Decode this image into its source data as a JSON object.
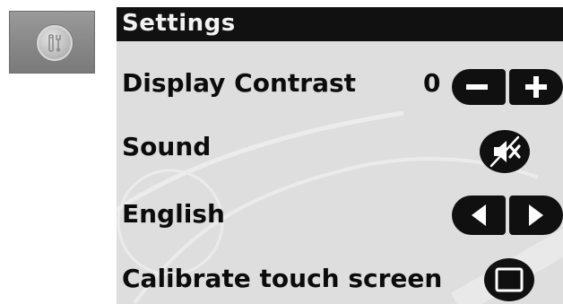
{
  "tool_tile": {
    "icon": "tools-icon"
  },
  "screen": {
    "title": "Settings",
    "rows": {
      "contrast": {
        "label": "Display Contrast",
        "value": "0",
        "decrease_icon": "minus-icon",
        "increase_icon": "plus-icon"
      },
      "sound": {
        "label": "Sound",
        "state": "muted",
        "icon": "speaker-muted-icon"
      },
      "language": {
        "label": "English",
        "prev_icon": "arrow-left-icon",
        "next_icon": "arrow-right-icon"
      },
      "calibrate": {
        "label": "Calibrate touch screen",
        "icon": "square-frame-icon"
      }
    }
  },
  "colors": {
    "screen_background": "#dedede",
    "title_bar": "#111111",
    "button": "#101010",
    "text": "#0c0c0c",
    "tile": "#878787"
  }
}
